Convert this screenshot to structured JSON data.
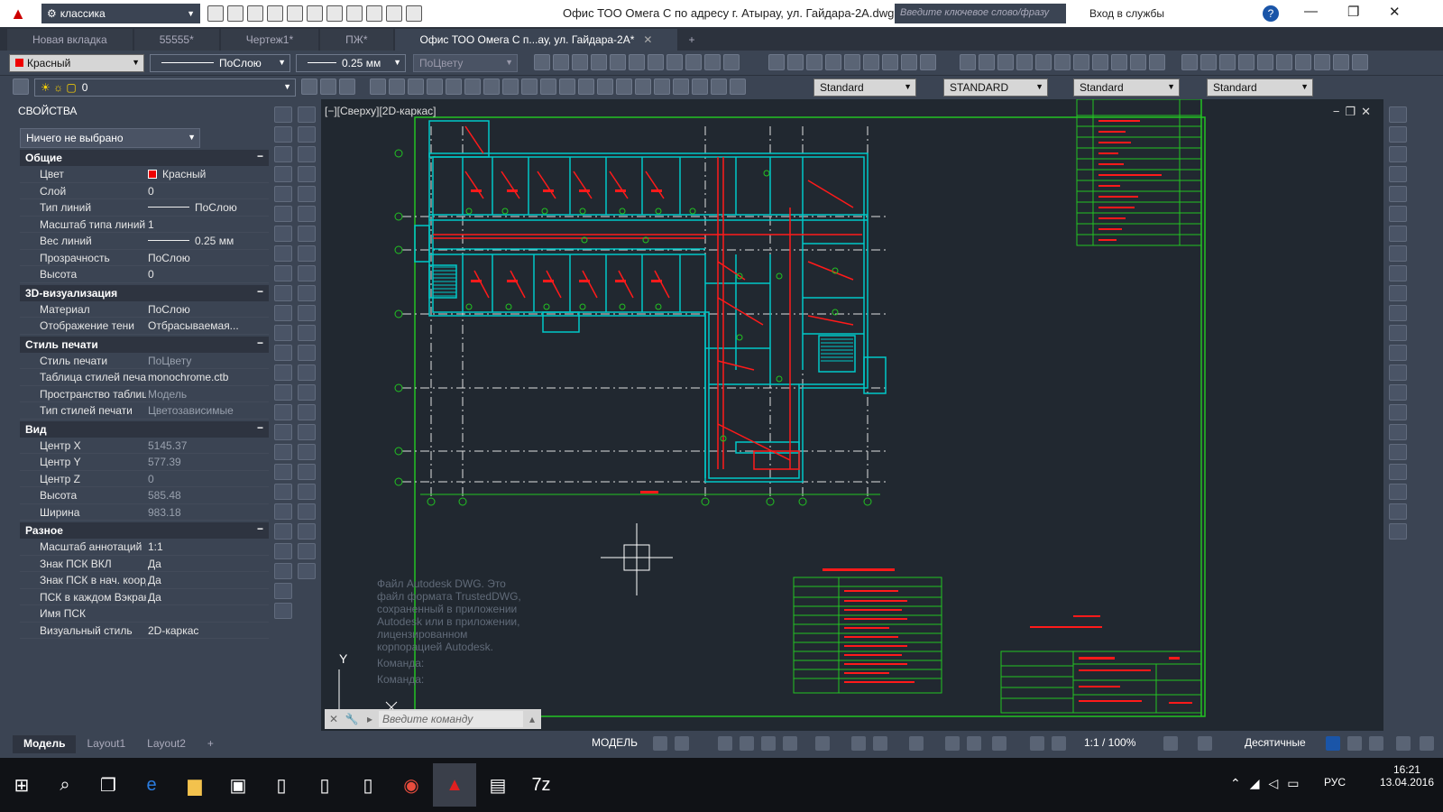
{
  "app": {
    "window_title": "Офис ТОО Омега С по адресу г. Атырау, ул. Гайдара-2А.dwg",
    "workspace": "классика",
    "search_placeholder": "Введите ключевое слово/фразу",
    "signin": "Вход в службы"
  },
  "tabs": [
    {
      "label": "Новая вкладка"
    },
    {
      "label": "55555*"
    },
    {
      "label": "Чертеж1*"
    },
    {
      "label": "ПЖ*"
    },
    {
      "label": "Офис ТОО Омега С п...ау, ул. Гайдара-2А*",
      "active": true
    }
  ],
  "toolbar": {
    "color": "Красный",
    "linetype": "ПоСлою",
    "lineweight": "0.25 мм",
    "plotstyle": "ПоЦвету",
    "layer": "0",
    "text_style": "Standard",
    "dim_style": "STANDARD",
    "table_style": "Standard",
    "mleader_style": "Standard"
  },
  "properties": {
    "title": "СВОЙСТВА",
    "selection": "Ничего не выбрано",
    "sections": [
      {
        "name": "Общие",
        "rows": [
          {
            "k": "Цвет",
            "v": "Красный"
          },
          {
            "k": "Слой",
            "v": "0"
          },
          {
            "k": "Тип линий",
            "v": "ПоСлою"
          },
          {
            "k": "Масштаб типа линий",
            "v": "1"
          },
          {
            "k": "Вес линий",
            "v": "0.25 мм"
          },
          {
            "k": "Прозрачность",
            "v": "ПоСлою"
          },
          {
            "k": "Высота",
            "v": "0"
          }
        ]
      },
      {
        "name": "3D-визуализация",
        "rows": [
          {
            "k": "Материал",
            "v": "ПоСлою"
          },
          {
            "k": "Отображение тени",
            "v": "Отбрасываемая..."
          }
        ]
      },
      {
        "name": "Стиль печати",
        "rows": [
          {
            "k": "Стиль печати",
            "v": "ПоЦвету"
          },
          {
            "k": "Таблица стилей печати",
            "v": "monochrome.ctb"
          },
          {
            "k": "Пространство таблиц...",
            "v": "Модель"
          },
          {
            "k": "Тип стилей печати",
            "v": "Цветозависимые"
          }
        ]
      },
      {
        "name": "Вид",
        "rows": [
          {
            "k": "Центр X",
            "v": "5145.37"
          },
          {
            "k": "Центр Y",
            "v": "577.39"
          },
          {
            "k": "Центр Z",
            "v": "0"
          },
          {
            "k": "Высота",
            "v": "585.48"
          },
          {
            "k": "Ширина",
            "v": "983.18"
          }
        ]
      },
      {
        "name": "Разное",
        "rows": [
          {
            "k": "Масштаб аннотаций",
            "v": "1:1"
          },
          {
            "k": "Знак ПСК ВКЛ",
            "v": "Да"
          },
          {
            "k": "Знак ПСК в нач. коорд.",
            "v": "Да"
          },
          {
            "k": "ПСК в каждом Вэкране",
            "v": "Да"
          },
          {
            "k": "Имя ПСК",
            "v": ""
          },
          {
            "k": "Визуальный стиль",
            "v": "2D-каркас"
          }
        ]
      }
    ]
  },
  "viewport": {
    "label": "[−][Сверху][2D-каркас]",
    "ucs_y": "Y",
    "command_history": "Файл Autodesk DWG. Это файл формата TrustedDWG, сохраненный в приложении Autodesk или в приложении, лицензированном корпорацией Autodesk.",
    "command_line1": "Команда:",
    "command_line2": "Команда:",
    "command_placeholder": "Введите команду"
  },
  "status": {
    "layout_tabs": [
      "Модель",
      "Layout1",
      "Layout2"
    ],
    "model": "МОДЕЛЬ",
    "scale": "1:1 / 100%",
    "units": "Десятичные"
  },
  "taskbar": {
    "time": "16:21",
    "date": "13.04.2016",
    "lang": "РУС"
  },
  "colors": {
    "accent": "#1a55a8",
    "drawing_walls": "#00c8c8",
    "drawing_wiring": "#ff1a1a",
    "drawing_frame": "#22c322"
  }
}
